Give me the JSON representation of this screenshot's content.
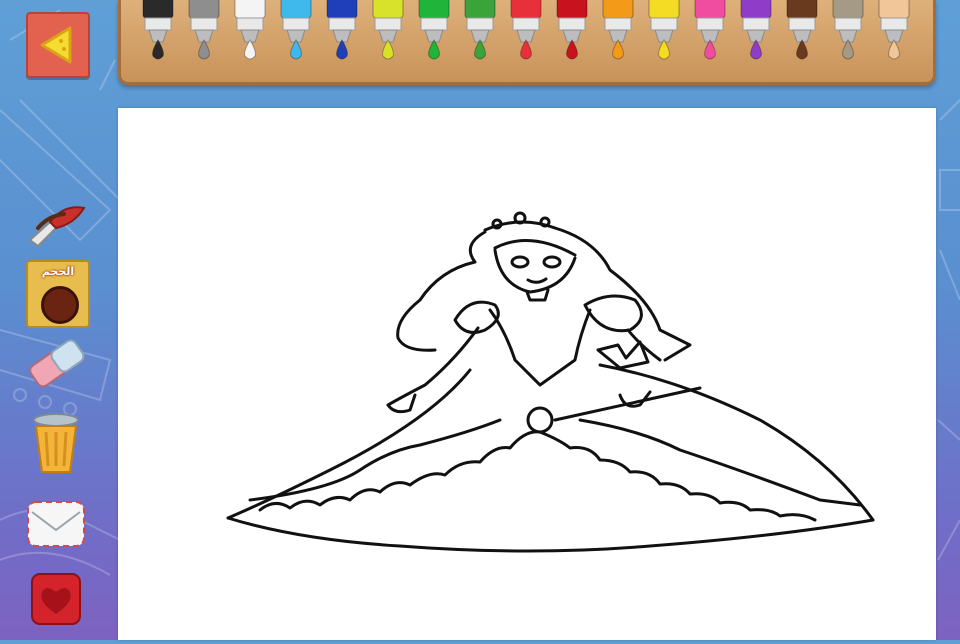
{
  "app": {
    "accent": "#5f9fd6"
  },
  "palette": {
    "markers": [
      {
        "name": "black",
        "color": "#2a2a2a"
      },
      {
        "name": "gray",
        "color": "#8e8e8e"
      },
      {
        "name": "white",
        "color": "#f4f4f4"
      },
      {
        "name": "light-blue",
        "color": "#3fb8ec"
      },
      {
        "name": "blue",
        "color": "#1f3fb8"
      },
      {
        "name": "yellow-green",
        "color": "#d8e22a"
      },
      {
        "name": "green",
        "color": "#21b43a"
      },
      {
        "name": "dark-green",
        "color": "#3aa33a"
      },
      {
        "name": "red",
        "color": "#e8303a"
      },
      {
        "name": "dark-red",
        "color": "#c8121e"
      },
      {
        "name": "orange",
        "color": "#f39a18"
      },
      {
        "name": "yellow",
        "color": "#f5dc24"
      },
      {
        "name": "pink",
        "color": "#f04da0"
      },
      {
        "name": "purple",
        "color": "#8f3dc8"
      },
      {
        "name": "brown",
        "color": "#6a3a1e"
      },
      {
        "name": "tan",
        "color": "#a49a86"
      },
      {
        "name": "peach",
        "color": "#f1c79a"
      }
    ]
  },
  "tools": {
    "back_icon": "back-arrow-icon",
    "brush_icon": "paintbrush-icon",
    "size": {
      "label": "الحجم",
      "color": "#6b2412"
    },
    "eraser_icon": "eraser-icon",
    "trash_icon": "trash-can-icon",
    "mail_icon": "envelope-icon",
    "heart_icon": "heart-icon"
  },
  "canvas": {
    "drawing": "princess-outline"
  }
}
